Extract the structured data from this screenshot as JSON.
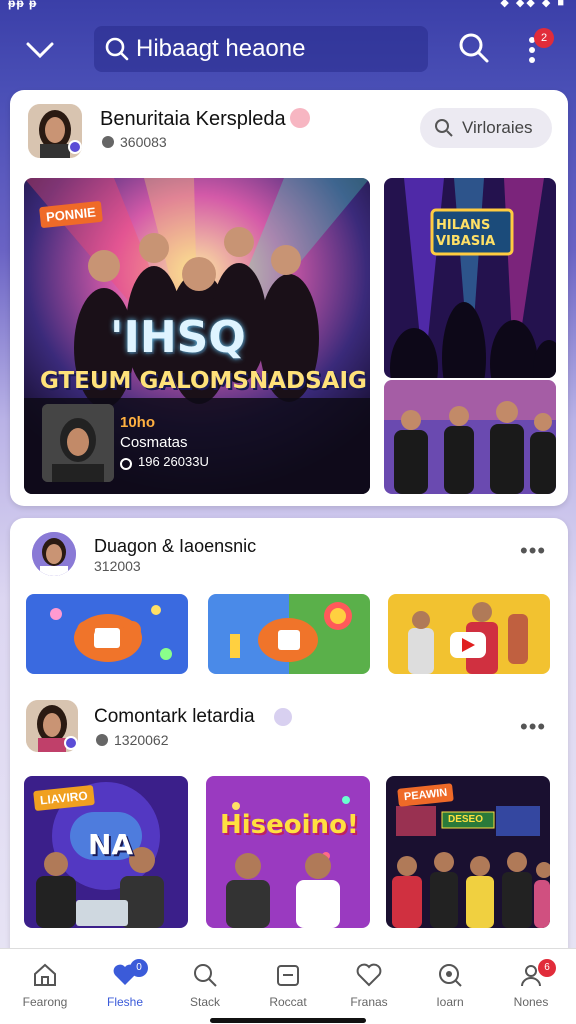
{
  "status_bar": {
    "left_text": "ᵽᵽ ᵽ",
    "right_text": "◆ ◆◆ ◆ ■"
  },
  "search": {
    "query": "Hibaagt heaone"
  },
  "notifications": {
    "count": "2"
  },
  "channels": [
    {
      "name": "Benuritaia Kerspleda",
      "meta": "360083",
      "action_label": "Virloraies",
      "featured": {
        "badge": "PONNIE",
        "title_main": "'IHSQ",
        "title_sub": "GTEUM GALOMSNADSAIG",
        "caption_title": "10ho",
        "caption_name": "Cosmatas",
        "caption_meta": "196 26033U"
      },
      "side_top_title": "HILANS VIBASIA"
    },
    {
      "name": "Duagon & Iaoensnic",
      "meta": "312003"
    },
    {
      "name": "Comontark letardia",
      "meta": "1320062",
      "thumbs": [
        {
          "badge": "LIAVIRO",
          "overlay": "NA"
        },
        {
          "overlay": "Hiseoino!"
        },
        {
          "badge": "PEAWIN",
          "sign": "DESEO"
        }
      ]
    }
  ],
  "bottom_nav": [
    {
      "label": "Fearong",
      "icon": "home-icon"
    },
    {
      "label": "Fleshe",
      "icon": "heart-icon",
      "badge": "0"
    },
    {
      "label": "Stack",
      "icon": "search-icon"
    },
    {
      "label": "Roccat",
      "icon": "calendar-icon"
    },
    {
      "label": "Franas",
      "icon": "heart-outline-icon"
    },
    {
      "label": "Ioarn",
      "icon": "magnifier-icon"
    },
    {
      "label": "Nones",
      "icon": "profile-icon",
      "badge": "6"
    }
  ],
  "colors": {
    "accent": "#3b5bd9",
    "badge_red": "#e12c3a",
    "header_bg": "#3b3fa8"
  }
}
